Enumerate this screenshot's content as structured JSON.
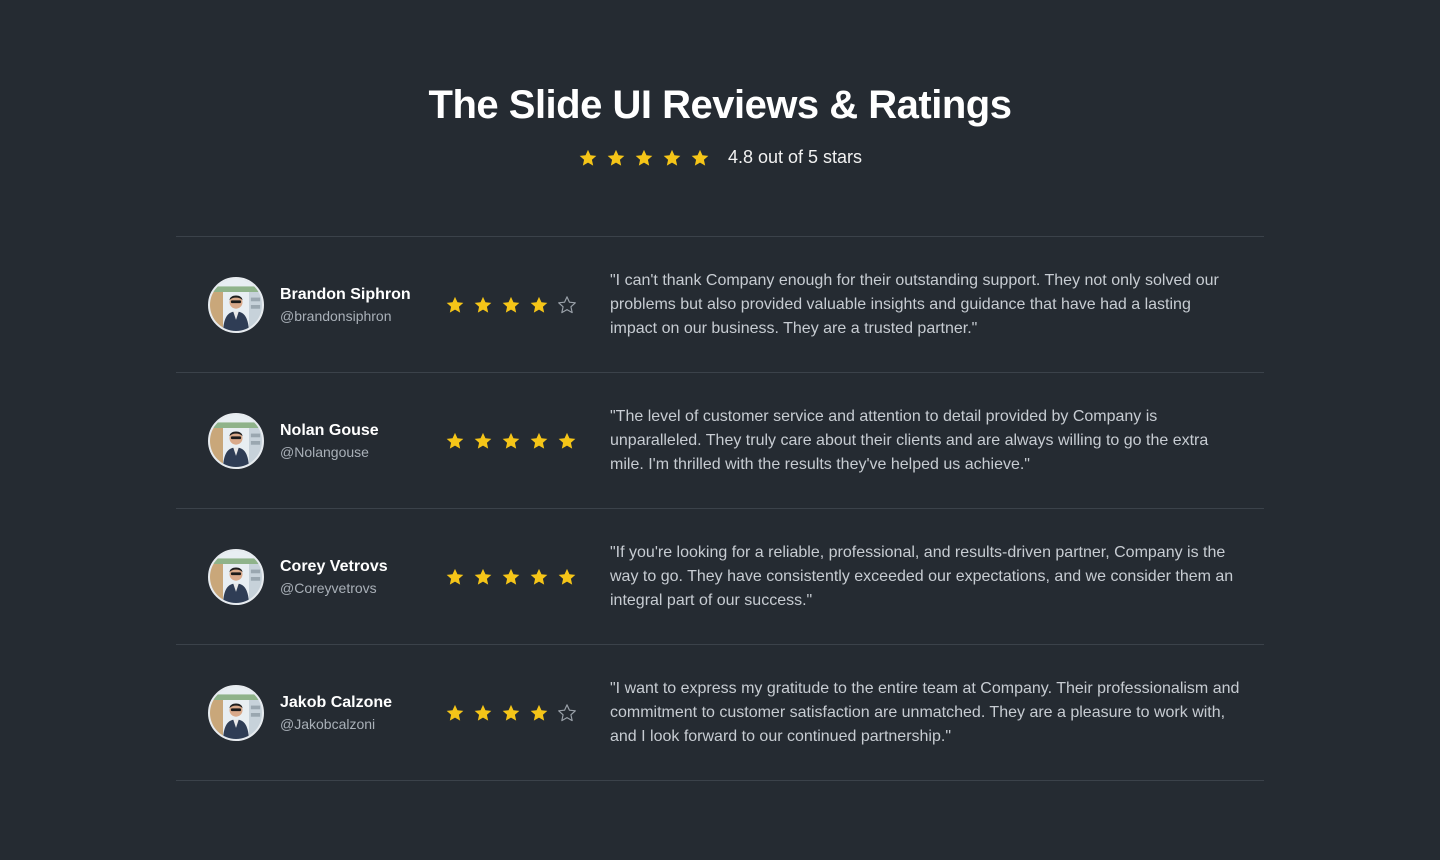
{
  "header": {
    "title": "The Slide UI Reviews & Ratings",
    "rating_text": "4.8 out of 5 stars",
    "stars": 5
  },
  "colors": {
    "background": "#252b32",
    "star_filled": "#f5c518",
    "star_empty": "#9aa1a9",
    "divider": "#3b424a"
  },
  "reviews": [
    {
      "name": "Brandon Siphron",
      "handle": "@brandonsiphron",
      "rating": 4,
      "quote": "\"I can't thank Company enough for their outstanding support. They not only solved our problems but also provided valuable insights and guidance that have had a lasting impact on our business. They are a trusted partner.\""
    },
    {
      "name": "Nolan Gouse",
      "handle": "@Nolangouse",
      "rating": 5,
      "quote": "\"The level of customer service and attention to detail provided by Company is unparalleled. They truly care about their clients and are always willing to go the extra mile. I'm thrilled with the results they've helped us achieve.\""
    },
    {
      "name": "Corey Vetrovs",
      "handle": "@Coreyvetrovs",
      "rating": 5,
      "quote": "\"If you're looking for a reliable, professional, and results-driven partner, Company is the way to go. They have consistently exceeded our expectations, and we consider them an integral part of our success.\""
    },
    {
      "name": "Jakob Calzone",
      "handle": "@Jakobcalzoni",
      "rating": 4,
      "quote": "\"I want to express my gratitude to the entire team at Company. Their professionalism and commitment to customer satisfaction are unmatched. They are a pleasure to work with, and I look forward to our continued partnership.\""
    }
  ]
}
